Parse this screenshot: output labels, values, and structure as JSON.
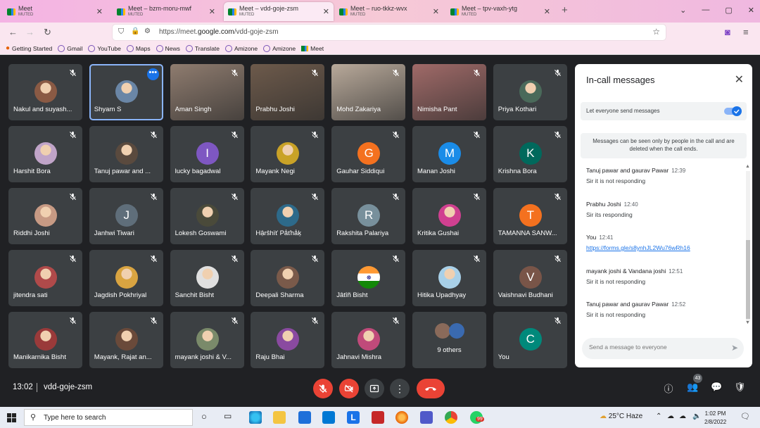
{
  "browser": {
    "tabs": [
      {
        "title": "Meet",
        "sub": "MUTED",
        "active": false
      },
      {
        "title": "Meet – bzm-moru-mwf",
        "sub": "MUTED",
        "active": false
      },
      {
        "title": "Meet – vdd-goje-zsm",
        "sub": "MUTED",
        "active": true
      },
      {
        "title": "Meet – ruo-tkkz-wvx",
        "sub": "MUTED",
        "active": false
      },
      {
        "title": "Meet – tpv-vaxh-ytg",
        "sub": "MUTED",
        "active": false
      }
    ],
    "new_tab": "+",
    "url_prefix": "https://meet.",
    "url_domain": "google.com",
    "url_path": "/vdd-goje-zsm",
    "bookmarks": [
      "Getting Started",
      "Gmail",
      "YouTube",
      "Maps",
      "News",
      "Translate",
      "Amizone",
      "Amizone",
      "Meet"
    ]
  },
  "meeting": {
    "clock": "13:02",
    "code": "vdd-goje-zsm",
    "participants_count": "43",
    "tiles": [
      {
        "name": "Nakul and suyash...",
        "kind": "photo",
        "color": "#8a5a44"
      },
      {
        "name": "Shyam S",
        "kind": "photo",
        "color": "#6a86a6",
        "selected": true
      },
      {
        "name": "Aman Singh",
        "kind": "video",
        "color": "#8f7c6f"
      },
      {
        "name": "Prabhu Joshi",
        "kind": "video",
        "color": "#6d5a4b"
      },
      {
        "name": "Mohd Zakariya",
        "kind": "video",
        "color": "#b8a99a"
      },
      {
        "name": "Nimisha Pant",
        "kind": "video",
        "color": "#a06a68"
      },
      {
        "name": "Priya Kothari",
        "kind": "photo",
        "color": "#4a6a5a"
      },
      {
        "name": "Harshit Bora",
        "kind": "photo",
        "color": "#c0a4c8"
      },
      {
        "name": "Tanuj pawar and ...",
        "kind": "photo",
        "color": "#5a4a3e"
      },
      {
        "name": "lucky bagadwal",
        "kind": "initial",
        "initial": "I",
        "color": "#7e57c2"
      },
      {
        "name": "Mayank Negi",
        "kind": "photo",
        "color": "#c9a227"
      },
      {
        "name": "Gauhar Siddiqui",
        "kind": "initial",
        "initial": "G",
        "color": "#f4711f"
      },
      {
        "name": "Manan Joshi",
        "kind": "initial",
        "initial": "M",
        "color": "#1a8ce8"
      },
      {
        "name": "Krishna Bora",
        "kind": "initial",
        "initial": "K",
        "color": "#00695c"
      },
      {
        "name": "Riddhi Joshi",
        "kind": "photo",
        "color": "#c79a84"
      },
      {
        "name": "Janhwi Tiwari",
        "kind": "initial",
        "initial": "J",
        "color": "#5f6e7a"
      },
      {
        "name": "Lokesh Goswami",
        "kind": "photo",
        "color": "#4a4a3a"
      },
      {
        "name": "Hậrŝhïť Pǻťhǻķ",
        "kind": "photo",
        "color": "#2d6a8a"
      },
      {
        "name": "Rakshita Palariya",
        "kind": "initial",
        "initial": "R",
        "color": "#78909c"
      },
      {
        "name": "Kritika Gushai",
        "kind": "photo",
        "color": "#d04090"
      },
      {
        "name": "TAMANNA SANW...",
        "kind": "initial",
        "initial": "T",
        "color": "#f4711f"
      },
      {
        "name": "jitendra sati",
        "kind": "photo",
        "color": "#b04a4a"
      },
      {
        "name": "Jagdish Pokhriyal",
        "kind": "photo",
        "color": "#d9a441"
      },
      {
        "name": "Sanchit Bisht",
        "kind": "photo",
        "color": "#e0e0e0"
      },
      {
        "name": "Deepali Sharma",
        "kind": "photo",
        "color": "#7a5a4a"
      },
      {
        "name": "Jâtîñ Bisht",
        "kind": "flag",
        "color": "#ff9933"
      },
      {
        "name": "Hitika Upadhyay",
        "kind": "photo",
        "color": "#a8d0e8"
      },
      {
        "name": "Vaishnavi Budhani",
        "kind": "initial",
        "initial": "V",
        "color": "#795548"
      },
      {
        "name": "Manikarnika Bisht",
        "kind": "photo",
        "color": "#9a3a3a"
      },
      {
        "name": "Mayank, Rajat an...",
        "kind": "photo",
        "color": "#6a4a3a"
      },
      {
        "name": "mayank joshi & V...",
        "kind": "photo",
        "color": "#7a8a6a"
      },
      {
        "name": "Raju Bhai",
        "kind": "photo",
        "color": "#8a4aa0"
      },
      {
        "name": "Jahnavi Mishra",
        "kind": "photo",
        "color": "#c04a7a"
      },
      {
        "name": "9 others",
        "kind": "others",
        "color": "#3a6ab0"
      },
      {
        "name": "You",
        "kind": "initial",
        "initial": "C",
        "color": "#00897b"
      }
    ]
  },
  "panel": {
    "title": "In-call messages",
    "toggle_label": "Let everyone send messages",
    "notice": "Messages can be seen only by people in the call and are deleted when the call ends.",
    "messages": [
      {
        "sender": "Tanuj pawar and gaurav Pawar",
        "time": "12:39",
        "text": "Sir it is not responding"
      },
      {
        "sender": "Prabhu Joshi",
        "time": "12:40",
        "text": "Sir its responding"
      },
      {
        "sender": "You",
        "time": "12:41",
        "link": "https://forms.gle/s8ynhJL2Wu76wRh16"
      },
      {
        "sender": "mayank joshi & Vandana joshi",
        "time": "12:51",
        "text": "Sir it is not responding"
      },
      {
        "sender": "Tanuj pawar and gaurav Pawar",
        "time": "12:52",
        "text": "Sir it is not responding"
      }
    ],
    "compose_placeholder": "Send a message to everyone"
  },
  "taskbar": {
    "search_placeholder": "Type here to search",
    "weather": "25°C Haze",
    "time": "1:02 PM",
    "date": "2/8/2022",
    "whatsapp_badge": "99"
  }
}
